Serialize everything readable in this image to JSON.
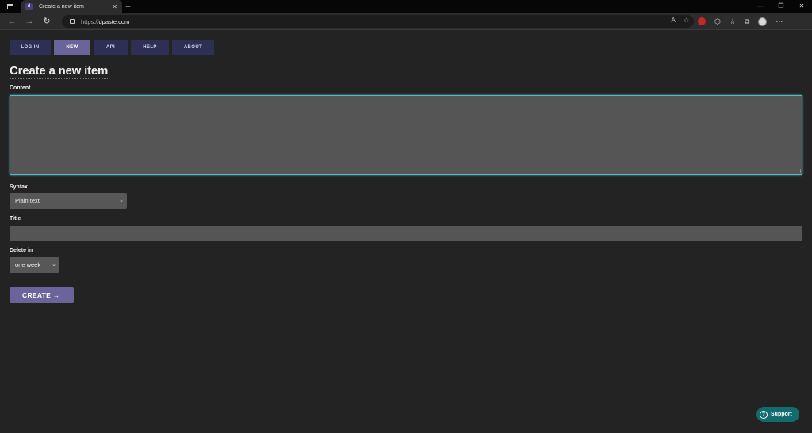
{
  "browser": {
    "tab_title": "Create a new item",
    "tab_favicon_text": "d",
    "url_prefix": "https://",
    "url_domain": "dpaste.com"
  },
  "nav": {
    "items": [
      {
        "label": "LOG IN",
        "active": false
      },
      {
        "label": "NEW",
        "active": true
      },
      {
        "label": "API",
        "active": false
      },
      {
        "label": "HELP",
        "active": false
      },
      {
        "label": "ABOUT",
        "active": false
      }
    ]
  },
  "form": {
    "heading": "Create a new item",
    "content_label": "Content",
    "content_value": "",
    "syntax_label": "Syntax",
    "syntax_value": "Plain text",
    "title_label": "Title",
    "title_value": "",
    "delete_label": "Delete in",
    "delete_value": "one week",
    "create_button": "CREATE →"
  },
  "support": {
    "label": "Support"
  },
  "colors": {
    "background": "#232323",
    "nav_button": "#2f2e55",
    "nav_active": "#6a649b",
    "input_bg": "#555555",
    "focus_border": "#59b9c9",
    "support_bg": "#126b6d"
  }
}
